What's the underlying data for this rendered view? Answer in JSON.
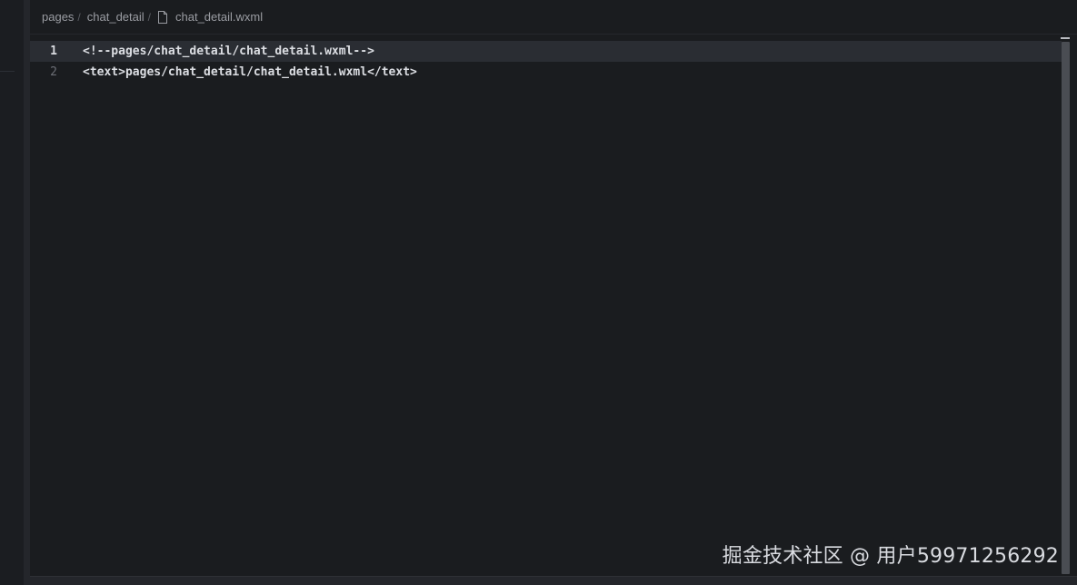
{
  "breadcrumb": {
    "items": [
      "pages",
      "chat_detail",
      "chat_detail.wxml"
    ],
    "separator": "/"
  },
  "editor": {
    "lines": [
      {
        "number": "1",
        "text": "<!--pages/chat_detail/chat_detail.wxml-->"
      },
      {
        "number": "2",
        "text": "<text>pages/chat_detail/chat_detail.wxml</text>"
      }
    ]
  },
  "watermark": "掘金技术社区 @ 用户59971256292",
  "colors": {
    "background": "#1a1c1f",
    "active_line": "#2a2d33",
    "text": "#dcdee3"
  },
  "icons": {
    "file": "file-icon"
  }
}
